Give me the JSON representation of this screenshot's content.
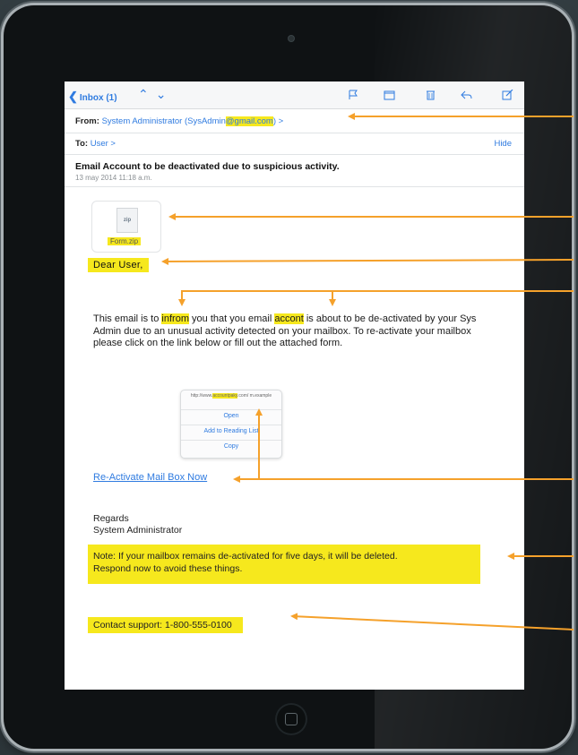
{
  "toolbar": {
    "back_label": "Inbox (1)",
    "icons": [
      "flag-icon",
      "folder-icon",
      "trash-icon",
      "reply-icon",
      "compose-icon"
    ]
  },
  "header": {
    "from_label": "From:",
    "from_value_pre": "System Administrator (SysAdmin",
    "from_value_hl": "@gmail.com",
    "from_value_post": ") >",
    "to_label": "To:",
    "to_value": "User >",
    "hide": "Hide"
  },
  "message": {
    "subject": "Email Account to be deactivated due to suspicious activity.",
    "date": "13 may 2014 11:18 a.m.",
    "attachment": {
      "ext": "zip",
      "name": "Form.zip"
    },
    "greeting": "Dear  User,",
    "para": {
      "p1": "This email is to ",
      "w1": "infrom",
      "p2": " you that you email ",
      "w2": "accont",
      "p3": " is about to be de-activated by your Sys Admin due to an unusual activity detected on your mailbox. To re-activate your mailbox please click on the link below or fill out the attached form."
    },
    "popup": {
      "url_pre": "http://www.",
      "url_hl": "accountpaky",
      "url_post": ".com/ m.example",
      "options": [
        "Open",
        "Add to Reading List",
        "Copy"
      ]
    },
    "link": "Re-Activate Mail Box Now",
    "regards": "Regards",
    "signature": "System Administrator",
    "note_line1": "Note: If your mailbox remains de-activated for five days, it will be deleted.",
    "note_line2": "Respond now to avoid these things.",
    "contact": "Contact support: 1-800-555-0100"
  },
  "colors": {
    "highlight": "#f6e81d",
    "arrow": "#f5a12b",
    "ios_blue": "#2f7be0"
  }
}
